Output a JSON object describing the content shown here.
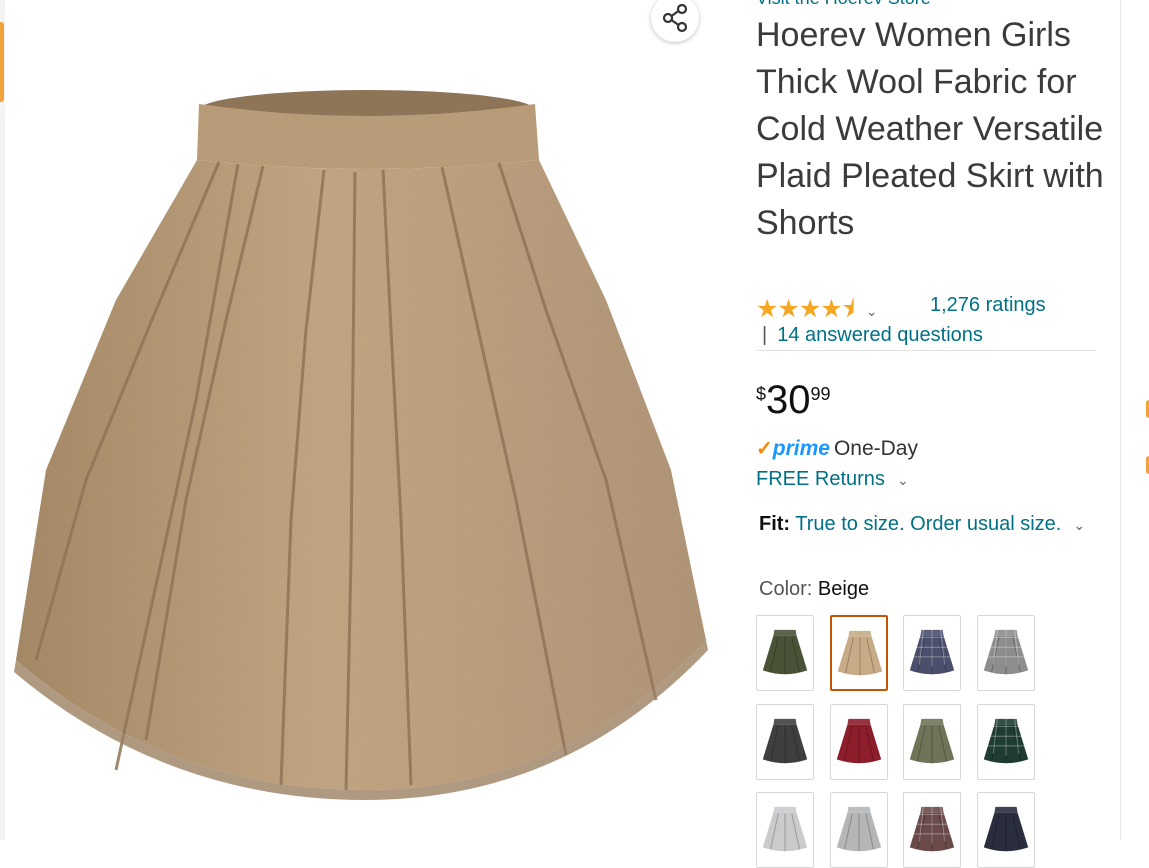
{
  "store_link": "Visit the Hoerev Store",
  "product": {
    "title": "Hoerev Women Girls Thick Wool Fabric for Cold Weather Versatile Plaid Pleated Skirt with Shorts",
    "stars": "★★★★⯨",
    "rating_value": 4.5,
    "ratings_count": "1,276 ratings",
    "qa_separator": "|",
    "answered_questions": "14 answered questions"
  },
  "price": {
    "symbol": "$",
    "whole": "30",
    "fraction": "99"
  },
  "delivery": {
    "prime_check": "✓",
    "prime_label": "prime",
    "prime_text": "One-Day",
    "returns_label": "FREE Returns"
  },
  "fit": {
    "label": "Fit:",
    "value": "True to size. Order usual size."
  },
  "color": {
    "label": "Color:",
    "selected": "Beige",
    "swatches": [
      {
        "name": "Army Green",
        "color": "#4a5338",
        "pattern": "solid"
      },
      {
        "name": "Beige",
        "color": "#c7ab86",
        "pattern": "solid",
        "selected": true
      },
      {
        "name": "Navy Plaid",
        "color": "#4b4f6b",
        "pattern": "plaid"
      },
      {
        "name": "Grey Plaid",
        "color": "#8d8d8f",
        "pattern": "plaid"
      },
      {
        "name": "Dark Grey",
        "color": "#3d3f40",
        "pattern": "solid"
      },
      {
        "name": "Wine Red",
        "color": "#8e1d2c",
        "pattern": "solid"
      },
      {
        "name": "Olive",
        "color": "#6f7358",
        "pattern": "solid"
      },
      {
        "name": "Dark Green Plaid",
        "color": "#1e3c34",
        "pattern": "plaid"
      },
      {
        "name": "Light Grey",
        "color": "#c9cbcc",
        "pattern": "solid"
      },
      {
        "name": "Silver Grey",
        "color": "#b4b6b8",
        "pattern": "solid"
      },
      {
        "name": "Brown Plaid",
        "color": "#6b4a4a",
        "pattern": "plaid"
      },
      {
        "name": "Navy",
        "color": "#2a2d3e",
        "pattern": "solid"
      }
    ]
  },
  "colors": {
    "link": "#007185",
    "star": "#f5a623",
    "prime_blue": "#1a98ff",
    "selected_border": "#c45500",
    "skirt_main": "#c2a57f"
  }
}
